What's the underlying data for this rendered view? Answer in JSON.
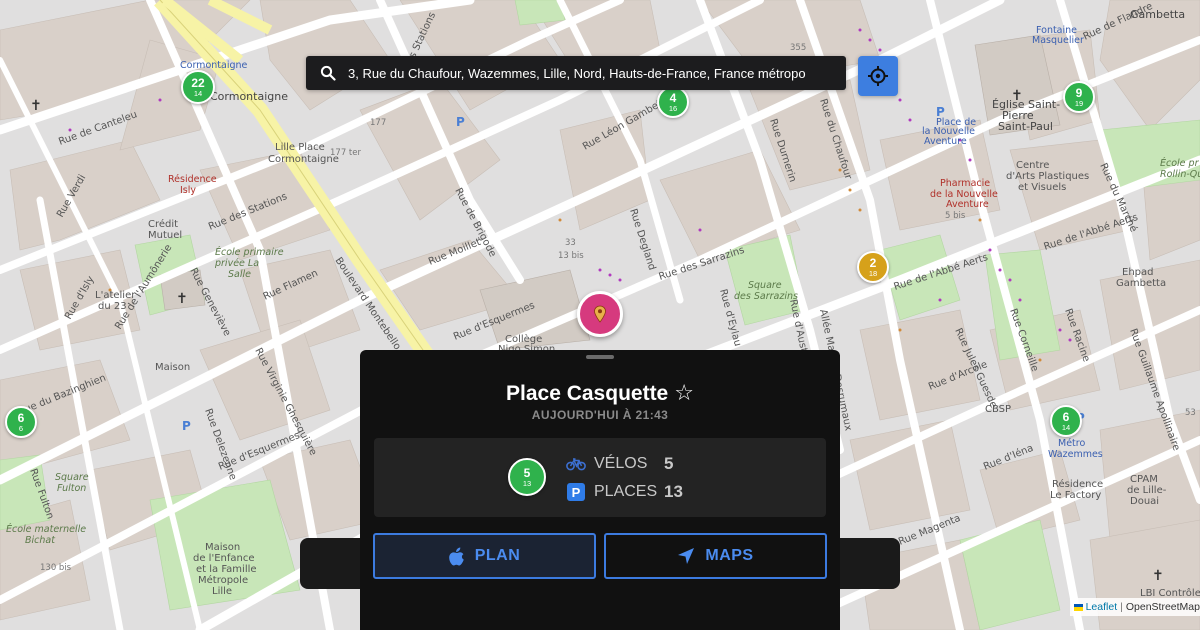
{
  "search": {
    "value": "3, Rue du Chaufour, Wazemmes, Lille, Nord, Hauts-de-France, France métropo"
  },
  "map_labels": {
    "streets": [
      "Rue de Canteleu",
      "Rue Verdi",
      "Rue des Stations",
      "Boulevard Montebello",
      "Rue de Brigode",
      "Rue Moillet",
      "Rue d'Esquermes",
      "Rue Léon Gambetta",
      "Rue Degland",
      "Rue des Sarrazins",
      "Rue d'Eylau",
      "Rue Durnerin",
      "Rue de l'Abbé Aerts",
      "Rue d'Arcole",
      "Rue d'Iéna",
      "Rue Magenta",
      "Rue Guillaume Apollinaire",
      "Rue du Marché",
      "Rue Fulton",
      "Rue Delezenne",
      "Rue Virginie Ghesquière",
      "Rue Flamen",
      "Rue du Bazinghien",
      "Rue Nationale",
      "Rue Jules Guesde",
      "Rue Racine",
      "Rue d'Austerlitz",
      "Allée Martha Desrumaux",
      "Rue Geneviève",
      "Rue d'Isly",
      "Rue de l'Aumônerie",
      "Rue Corneille",
      "Rue de Flandre",
      "Rue Jean Bart"
    ],
    "places": [
      "Cormontaigne",
      "Lille Place Cormontaigne",
      "Résidence Isly",
      "Crédit Mutuel",
      "École primaire privée La Salle",
      "Collège Nigo Simon",
      "Square des Sarrazins",
      "Place de la Nouvelle Aventure",
      "Église Saint-Pierre Saint-Paul",
      "Pharmacie de la Nouvelle Aventure",
      "Centre d'Arts Plastiques et Visuels",
      "Ehpad Gambetta",
      "École primaire Rollin-Quinet",
      "Square Fulton",
      "École maternelle Bichat",
      "Maison de l'Enfance et la Famille Métropole Lille",
      "Métro Wazemmes",
      "Résidence Le Factory",
      "CPAM de Lille-Douai",
      "Gambetta",
      "Fontaine Masquelier",
      "L'atelier du 23",
      "CBSP",
      "LBI Contrôle",
      "Maison"
    ]
  },
  "station_markers": [
    {
      "bikes": "22",
      "places": "14",
      "color": "#2fb24c"
    },
    {
      "bikes": "4",
      "places": "16",
      "color": "#2fb24c"
    },
    {
      "bikes": "9",
      "places": "19",
      "color": "#2fb24c"
    },
    {
      "bikes": "2",
      "places": "18",
      "color": "#d6a11a"
    },
    {
      "bikes": "6",
      "places": "6",
      "color": "#2fb24c"
    },
    {
      "bikes": "6",
      "places": "14",
      "color": "#2fb24c"
    }
  ],
  "sheet": {
    "title": "Place Casquette",
    "favorite_icon": "star-outline-icon",
    "updated": "AUJOURD'HUI À 21:43",
    "marker": {
      "bikes": "5",
      "places": "13"
    },
    "bikes_label": "VÉLOS",
    "bikes_value": "5",
    "places_label": "PLACES",
    "places_value": "13",
    "places_badge": "P",
    "plan_button": "PLAN",
    "maps_button": "MAPS"
  },
  "attribution": {
    "leaflet": "Leaflet",
    "separator": "|",
    "osm": "OpenStreetMap"
  },
  "colors": {
    "accent": "#3c7be0",
    "pin": "#d63a7e",
    "station_green": "#2fb24c",
    "station_yellow": "#d6a11a",
    "sheet_bg": "#111111"
  }
}
